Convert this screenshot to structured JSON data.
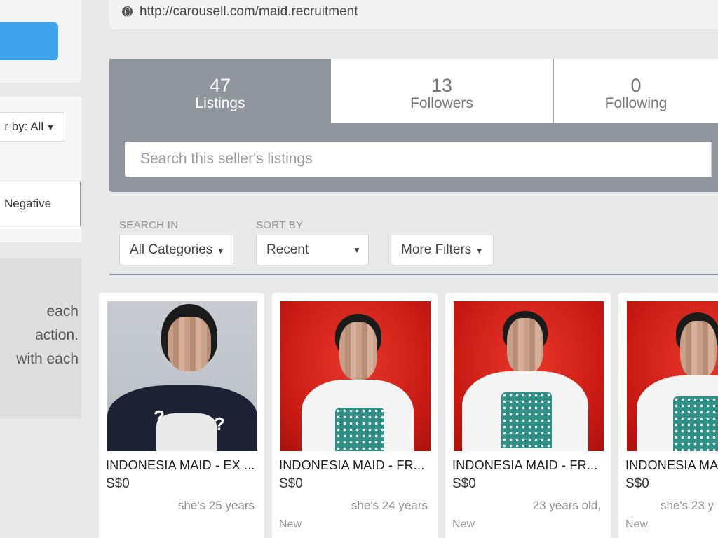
{
  "browser": {
    "url": "http://carousell.com/maid.recruitment"
  },
  "left": {
    "filter_label": "r by: All",
    "negative_tab": "Negative",
    "info_lines": [
      "each",
      "action.",
      "with each"
    ]
  },
  "stats": {
    "listings": {
      "count": "47",
      "label": "Listings"
    },
    "followers": {
      "count": "13",
      "label": "Followers"
    },
    "following": {
      "count": "0",
      "label": "Following"
    }
  },
  "search": {
    "placeholder": "Search this seller's listings"
  },
  "filters": {
    "search_in_label": "SEARCH IN",
    "search_in_value": "All Categories",
    "sort_by_label": "SORT BY",
    "sort_by_value": "Recent",
    "more_filters": "More Filters"
  },
  "listings": [
    {
      "title": "INDONESIA MAID - EX ...",
      "price": "S$0",
      "desc": "she's 25 years",
      "condition": ""
    },
    {
      "title": "INDONESIA MAID - FR...",
      "price": "S$0",
      "desc": "she's 24 years",
      "condition": "New"
    },
    {
      "title": "INDONESIA MAID - FR...",
      "price": "S$0",
      "desc": "23 years old,",
      "condition": "New"
    },
    {
      "title": "INDONESIA MA",
      "price": "S$0",
      "desc": "she's 23 y",
      "condition": "New"
    }
  ],
  "colors": {
    "accent_blue": "#3fa3ec",
    "header_grey": "#8e959d",
    "photo_red": "#c91a14"
  },
  "icons": {
    "url_bar": "globe-icon",
    "dropdown": "caret-down-icon"
  }
}
